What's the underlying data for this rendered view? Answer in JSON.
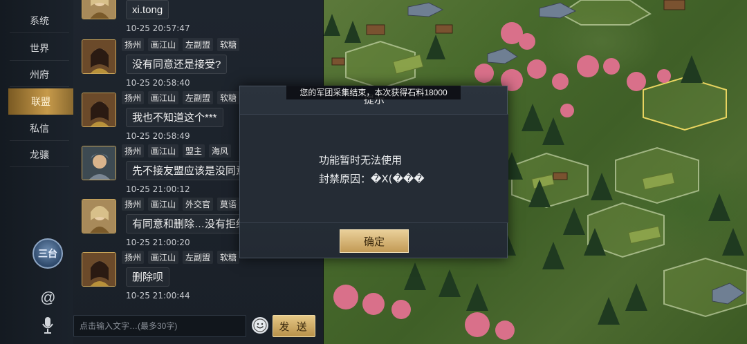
{
  "nav": {
    "items": [
      {
        "label": "系统"
      },
      {
        "label": "世界"
      },
      {
        "label": "州府"
      },
      {
        "label": "联盟",
        "active": true
      },
      {
        "label": "私信"
      },
      {
        "label": "龙骧"
      }
    ],
    "crest_text": "三台",
    "at_symbol": "@"
  },
  "chat": {
    "messages": [
      {
        "tags": [],
        "text": "xi.tong",
        "time": "10-25 20:57:47",
        "avatar": "female-portrait-gold"
      },
      {
        "tags": [
          "扬州",
          "画江山",
          "左副盟",
          "软糖"
        ],
        "text": "没有同意还是接受?",
        "time": "10-25 20:58:40",
        "avatar": "female-portrait-dark-hair"
      },
      {
        "tags": [
          "扬州",
          "画江山",
          "左副盟",
          "软糖"
        ],
        "text": "我也不知道这个***",
        "time": "10-25 20:58:49",
        "avatar": "female-portrait-dark-hair"
      },
      {
        "tags": [
          "扬州",
          "画江山",
          "盟主",
          "海风"
        ],
        "text": "先不接友盟应该是没同意",
        "time": "10-25 21:00:12",
        "avatar": "armored-warrior-portrait"
      },
      {
        "tags": [
          "扬州",
          "画江山",
          "外交官",
          "莫语"
        ],
        "text": "有同意和删除…没有拒绝",
        "time": "10-25 21:00:20",
        "avatar": "female-portrait-gold"
      },
      {
        "tags": [
          "扬州",
          "画江山",
          "左副盟",
          "软糖"
        ],
        "text": "删除呗",
        "time": "10-25 21:00:44",
        "avatar": "female-portrait-dark-hair"
      }
    ],
    "input_placeholder": "点击输入文字…(最多30字)",
    "send_label": "发 送"
  },
  "banner": {
    "text": "您的军团采集结束，本次获得石料18000"
  },
  "dialog": {
    "title": "提示",
    "line1": "功能暂时无法使用",
    "line2": "封禁原因：�X(���",
    "confirm_label": "确定"
  },
  "colors": {
    "accent_gold": "#c79a4a",
    "panel_bg": "#1e252e",
    "map_green": "#486a2c"
  }
}
